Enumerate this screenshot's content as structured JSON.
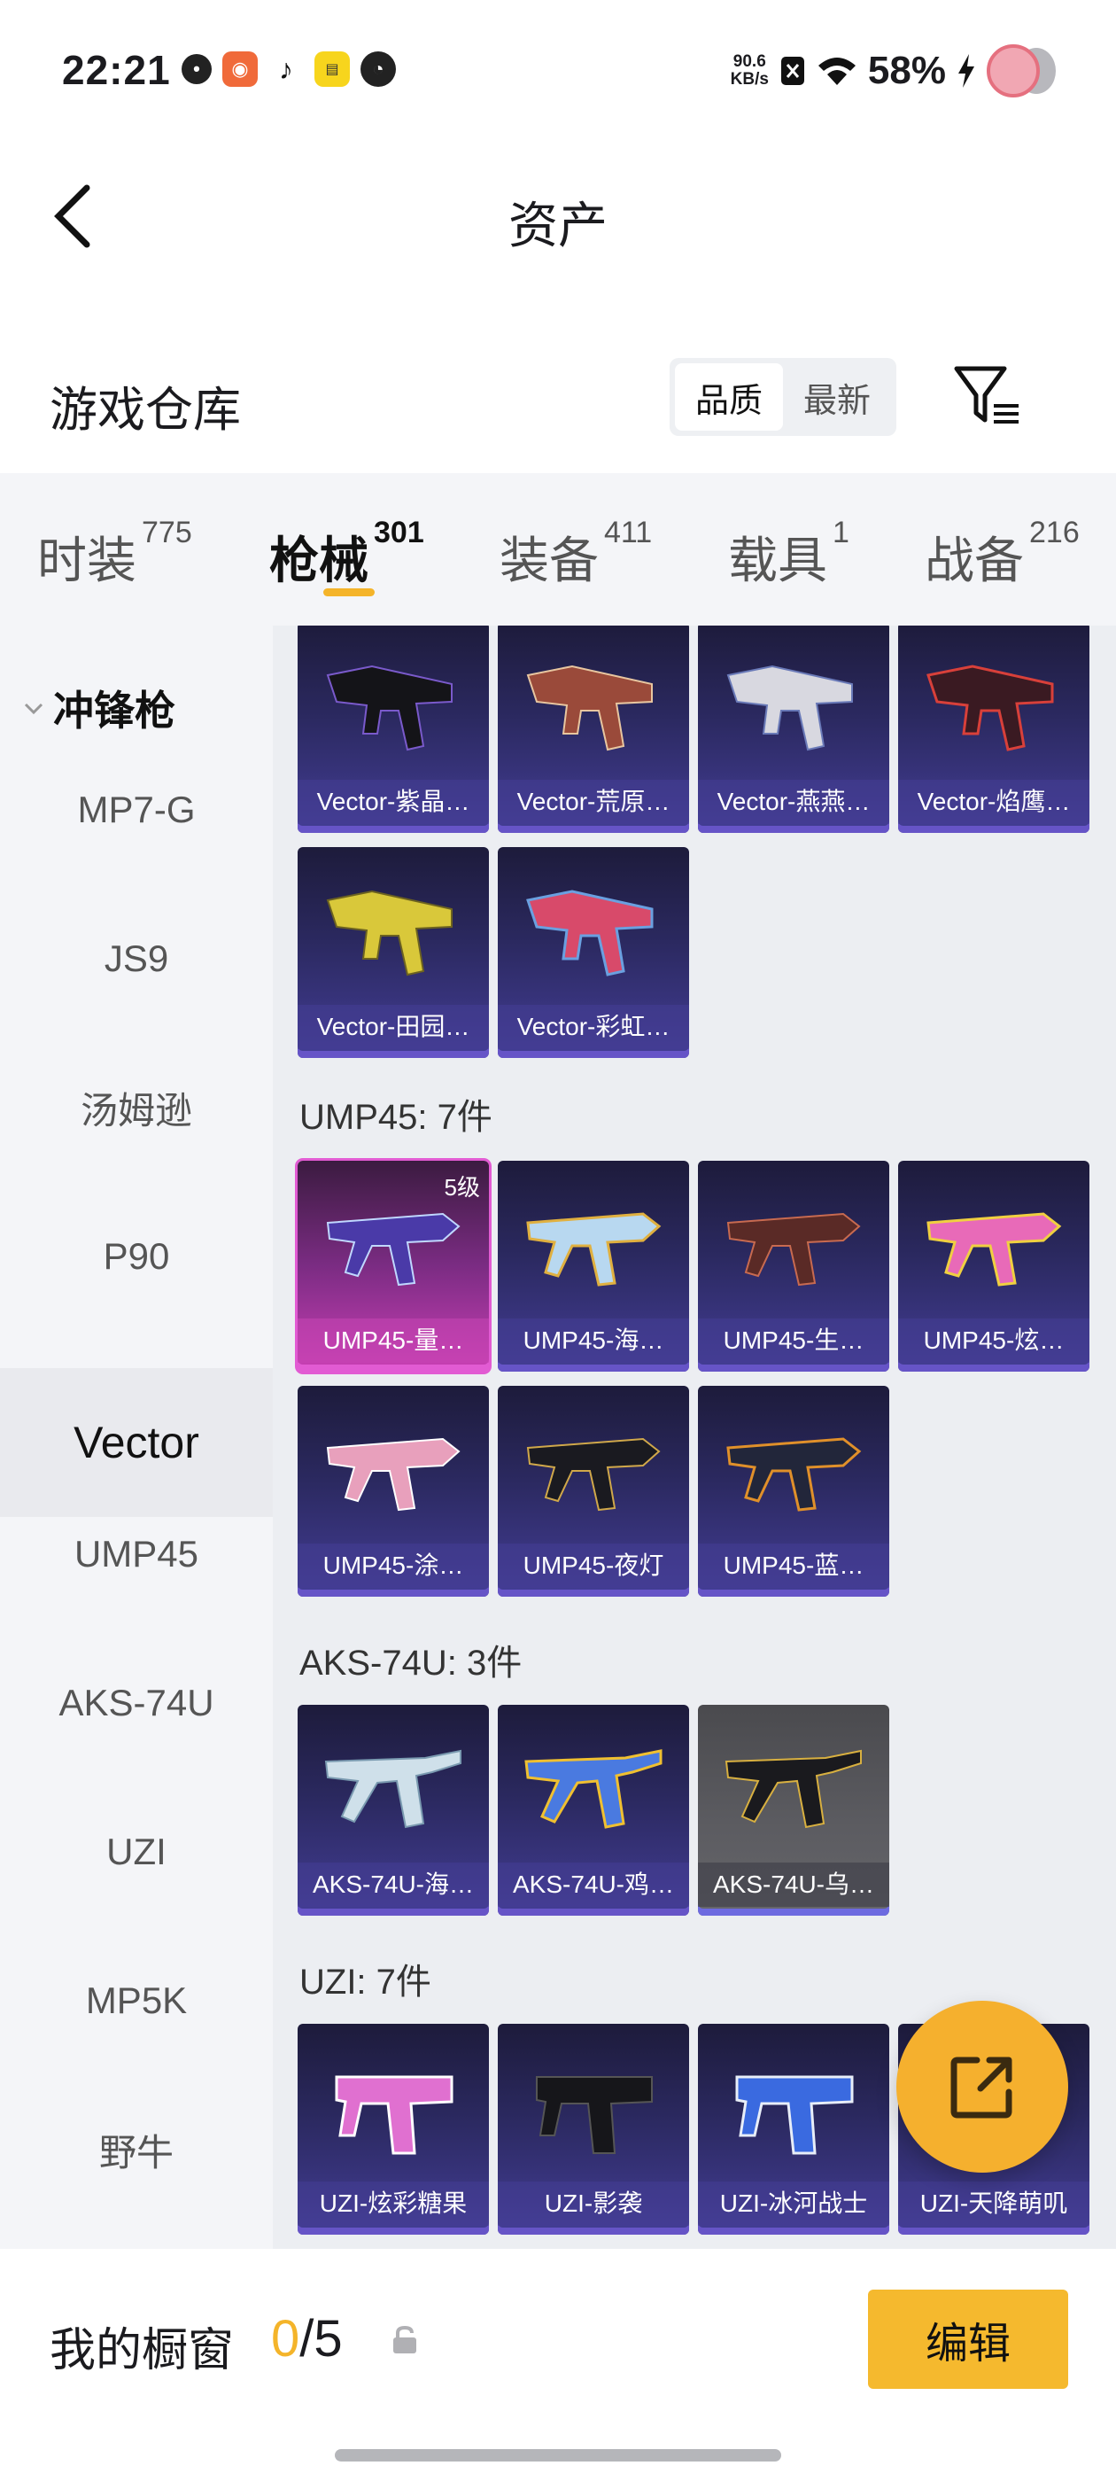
{
  "status_bar": {
    "time": "22:21",
    "speed_value": "90.6",
    "speed_unit": "KB/s",
    "battery": "58%"
  },
  "header": {
    "title": "资产"
  },
  "warehouse": {
    "title": "游戏仓库",
    "sort_options": [
      "品质",
      "最新"
    ],
    "active_sort": "品质"
  },
  "tabs": [
    {
      "label": "时装",
      "count": "775"
    },
    {
      "label": "枪械",
      "count": "301"
    },
    {
      "label": "装备",
      "count": "411"
    },
    {
      "label": "载具",
      "count": "1"
    },
    {
      "label": "战备",
      "count": "216"
    }
  ],
  "active_tab": "枪械",
  "sidebar": {
    "group": "冲锋枪",
    "items": [
      "MP7-G",
      "JS9",
      "汤姆逊",
      "P90",
      "Vector",
      "UMP45",
      "AKS-74U",
      "UZI",
      "MP5K",
      "野牛"
    ],
    "active": "Vector"
  },
  "sections": {
    "vector_items": [
      "Vector-紫晶…",
      "Vector-荒原…",
      "Vector-燕燕…",
      "Vector-焰鹰…",
      "Vector-田园…",
      "Vector-彩虹…"
    ],
    "ump45_title": "UMP45: 7件",
    "ump45_items": [
      "UMP45-量…",
      "UMP45-海…",
      "UMP45-生…",
      "UMP45-炫…",
      "UMP45-涂…",
      "UMP45-夜灯",
      "UMP45-蓝…"
    ],
    "ump45_level": "5级",
    "aks_title": "AKS-74U: 3件",
    "aks_items": [
      "AKS-74U-海…",
      "AKS-74U-鸡…",
      "AKS-74U-乌…"
    ],
    "uzi_title": "UZI: 7件",
    "uzi_items": [
      "UZI-炫彩糖果",
      "UZI-影袭",
      "UZI-冰河战士",
      "UZI-天降萌叽"
    ]
  },
  "bottom_bar": {
    "title": "我的橱窗",
    "count_used": "0",
    "count_total": "/5",
    "edit_label": "编辑"
  },
  "icons": [
    "back-arrow-icon",
    "filter-icon",
    "chevron-down-icon",
    "lock-icon",
    "share-icon"
  ],
  "colors": {
    "accent": "#f4b42a",
    "card_purple": "#433d95",
    "card_pink": "#c93fb4"
  }
}
